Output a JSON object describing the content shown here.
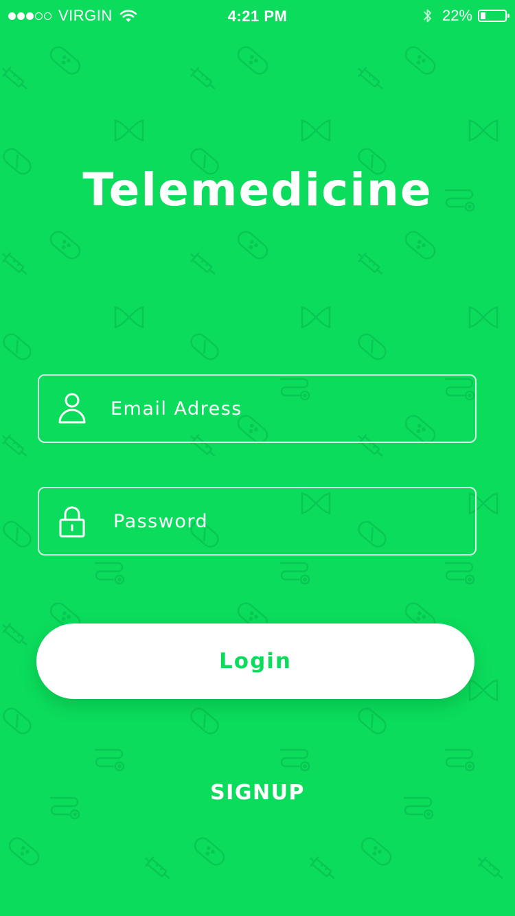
{
  "status_bar": {
    "carrier": "VIRGIN",
    "signal_strength": 3,
    "signal_max": 5,
    "time": "4:21 PM",
    "battery_percent_text": "22%",
    "battery_level": 0.22,
    "wifi_icon": "wifi-icon",
    "bluetooth_icon": "bluetooth-icon"
  },
  "app": {
    "title": "Telemedicine"
  },
  "form": {
    "email": {
      "placeholder": "Email Adress",
      "value": "",
      "icon": "user-icon"
    },
    "password": {
      "placeholder": "Password",
      "value": "",
      "icon": "lock-icon"
    },
    "login_label": "Login",
    "signup_label": "SIGNUP"
  },
  "colors": {
    "background": "#0bdc5c",
    "foreground": "#ffffff",
    "button_background": "#ffffff",
    "button_text": "#0bdc5c",
    "pattern": "#08c451"
  }
}
